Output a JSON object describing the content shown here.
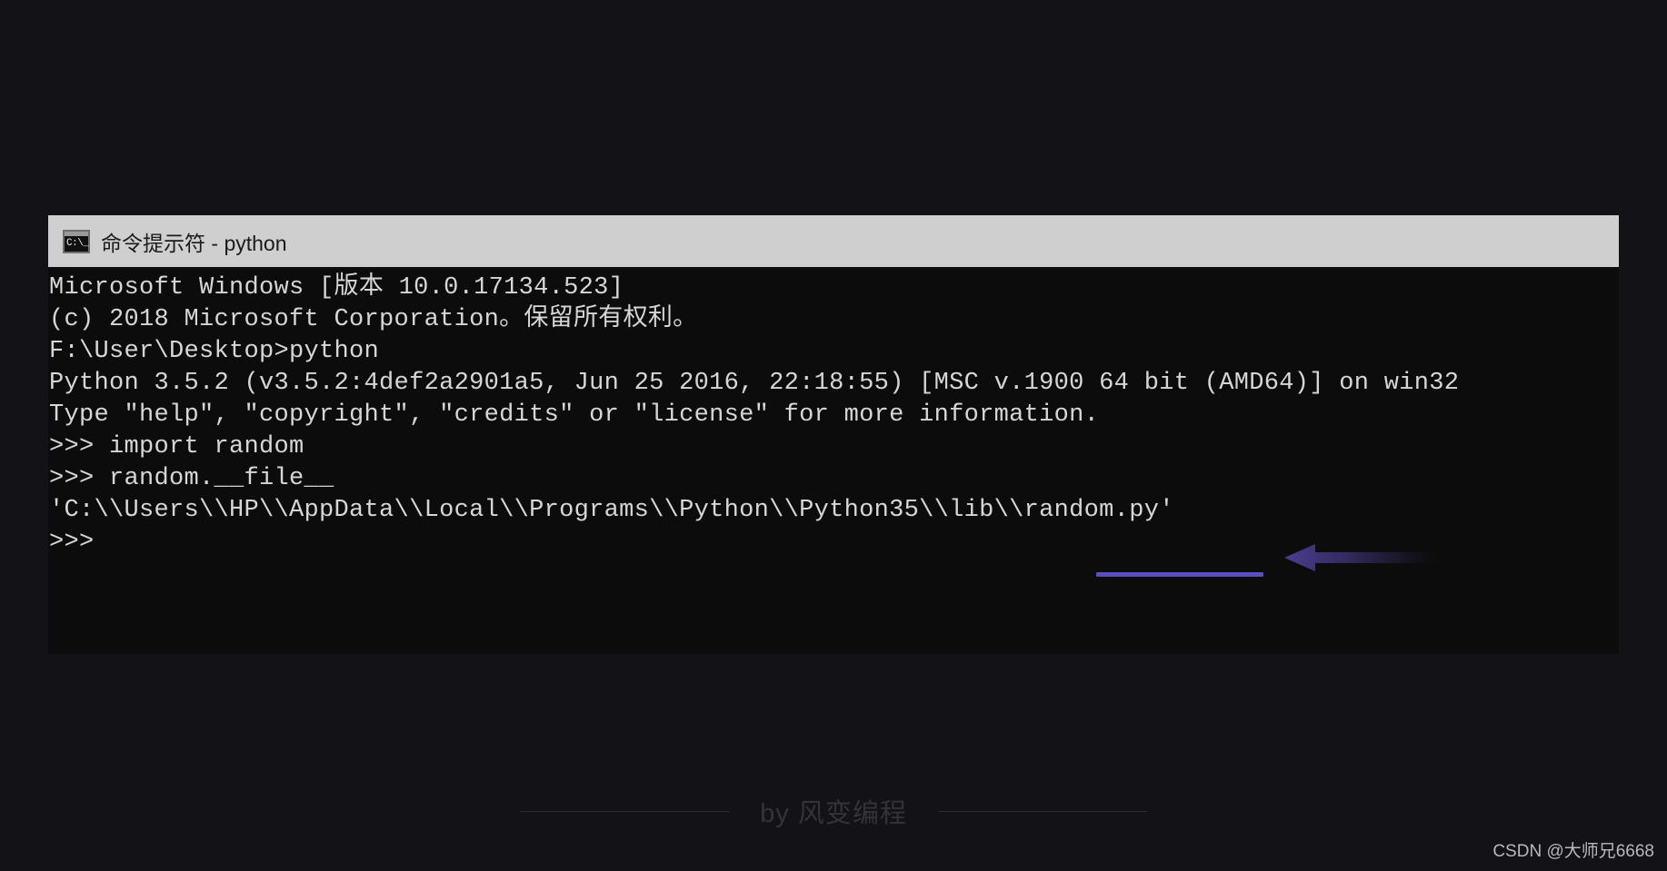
{
  "window": {
    "title": "命令提示符 - python",
    "icon_name": "cmd-console-icon",
    "icon_glyph": "C:\\_",
    "titlebar_color": "#cfcfcf",
    "background_color": "#0c0c0c"
  },
  "desktop": {
    "background_color": "#121217"
  },
  "terminal": {
    "text_color": "#d6d6d6",
    "lines": [
      "Microsoft Windows [版本 10.0.17134.523]",
      "(c) 2018 Microsoft Corporation。保留所有权利。",
      "",
      "F:\\User\\Desktop>python",
      "Python 3.5.2 (v3.5.2:4def2a2901a5, Jun 25 2016, 22:18:55) [MSC v.1900 64 bit (AMD64)] on win32",
      "Type \"help\", \"copyright\", \"credits\" or \"license\" for more information.",
      ">>> import random",
      ">>> random.__file__",
      "'C:\\\\Users\\\\HP\\\\AppData\\\\Local\\\\Programs\\\\Python\\\\Python35\\\\lib\\\\random.py'",
      ">>>"
    ]
  },
  "annotation": {
    "underline_label": "random.py",
    "underline_color": "#5b4fbf",
    "arrow_color": "#4a3f8f",
    "arrow_direction": "left"
  },
  "watermarks": {
    "center_text": "by 风变编程",
    "center_color": "#33333a",
    "corner_text": "CSDN @大师兄6668",
    "corner_color": "#b9b9bd"
  }
}
